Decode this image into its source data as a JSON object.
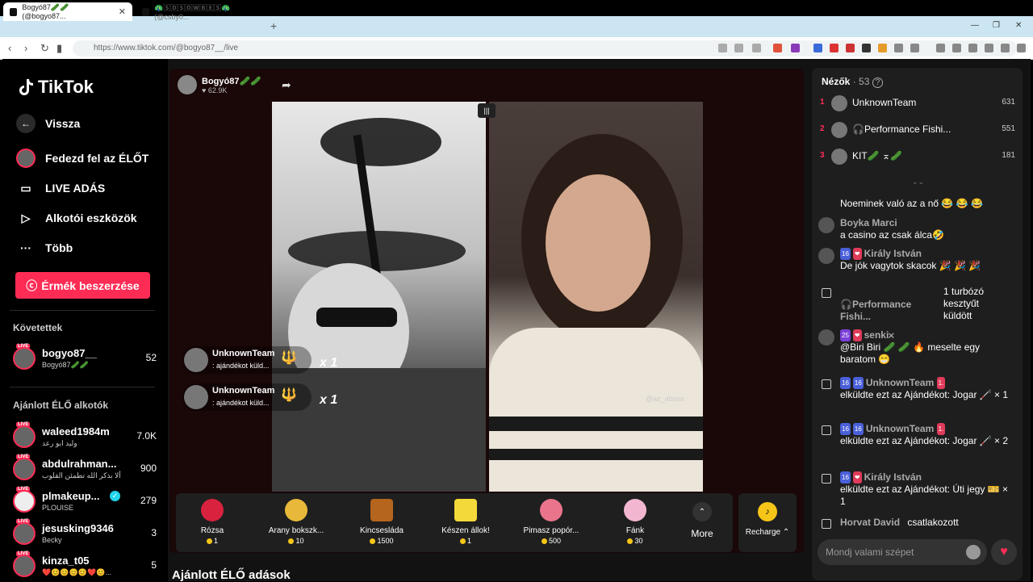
{
  "browser": {
    "tabs": [
      {
        "title": "Bogyó87🥒🥒 (@bogyo87..."
      },
      {
        "title": "🦚🅂🄳🅂🄾🅆🄱🄴🅂🦚 (@csby0..."
      }
    ],
    "new_tab": "+",
    "url": "https://www.tiktok.com/@bogyo87__/live",
    "window_controls": [
      "—",
      "❐",
      "✕"
    ]
  },
  "sidebar": {
    "logo": "TikTok",
    "back": "Vissza",
    "explore_live": "Fedezd fel az ÉLŐT",
    "live_studio": "LIVE ADÁS",
    "creator_tools": "Alkotói eszközök",
    "more": "Több",
    "buy_coins": "Érmék beszerzése",
    "following_title": "Követettek",
    "following": [
      {
        "name": "bogyo87__",
        "sub": "Bogyó87🥒🥒",
        "count": "52"
      }
    ],
    "suggested_title": "Ajánlott ÉLŐ alkotók",
    "suggested": [
      {
        "name": "waleed1984m",
        "sub": "وليد ابو رعد",
        "count": "7.0K"
      },
      {
        "name": "abdulrahman...",
        "sub": "ألا بذكر الله تطمئن القلوب",
        "count": "900"
      },
      {
        "name": "plmakeup...",
        "sub": "PLOUISE",
        "count": "279",
        "verified": true
      },
      {
        "name": "jesusking9346",
        "sub": "Becky",
        "count": "3"
      },
      {
        "name": "kinza_t05",
        "sub": "❤️😊😊😊😊❤️😊...",
        "count": "5"
      }
    ],
    "live_tag": "LIVE"
  },
  "stream": {
    "host_name": "Bogyó87🥒🥒",
    "host_likes": "62.9K",
    "watermark": "@az_aboss",
    "gift_popups": [
      {
        "user": "UnknownTeam",
        "text": ": ajándékot küld...",
        "mult": "x 1"
      },
      {
        "user": "UnknownTeam",
        "text": ": ajándékot küld...",
        "mult": "x 1"
      }
    ],
    "gifts": [
      {
        "name": "Rózsa",
        "price": "1"
      },
      {
        "name": "Arany bokszk...",
        "price": "10"
      },
      {
        "name": "Kincsesláda",
        "price": "1500"
      },
      {
        "name": "Készen állok!",
        "price": "1"
      },
      {
        "name": "Pimasz popór...",
        "price": "500"
      },
      {
        "name": "Fánk",
        "price": "30"
      }
    ],
    "more_label": "More",
    "recharge_label": "Recharge ⌃",
    "suggested_heading": "Ajánlott ÉLŐ adások"
  },
  "viewers": {
    "title": "Nézők",
    "count": "· 53",
    "list": [
      {
        "rank": "1",
        "name": "UnknownTeam",
        "score": "631"
      },
      {
        "rank": "2",
        "name": "🎧Performance Fishi...",
        "score": "551"
      },
      {
        "rank": "3",
        "name": "KIT🥒 ⌅🥒",
        "score": "181"
      }
    ]
  },
  "chat": {
    "messages": [
      {
        "author": "",
        "text": "Noeminek való az a nő 😂 😂 😂"
      },
      {
        "author": "Boyka Marci",
        "text": "a casino az csak álca🤣"
      },
      {
        "badges": [
          "16",
          "❤"
        ],
        "author": "Király István",
        "text": "De jók vagytok skacok 🎉 🎉 🎉"
      },
      {
        "author": "🎧Performance Fishi...",
        "text": "1 turbózó kesztyűt küldött"
      },
      {
        "badges": [
          "25",
          "❤"
        ],
        "author": "senki𐄂",
        "text": "@Biri Biri 🥒 🥒 🔥 meselte egy baratom 😁"
      },
      {
        "badges": [
          "16",
          "16"
        ],
        "author": "UnknownTeam",
        "extra": "1.",
        "text": "elküldte ezt az Ajándékot: Jogar 🦯 × 1"
      },
      {
        "badges": [
          "16",
          "16"
        ],
        "author": "UnknownTeam",
        "extra": "1.",
        "text": "elküldte ezt az Ajándékot: Jogar 🦯 × 2"
      },
      {
        "badges": [
          "16",
          "❤"
        ],
        "author": "Király István",
        "text": "elküldte ezt az Ajándékot: Úti jegy 🎫 × 1"
      },
      {
        "author": "Horvat David",
        "text": "csatlakozott"
      }
    ],
    "input_placeholder": "Mondj valami szépet"
  }
}
